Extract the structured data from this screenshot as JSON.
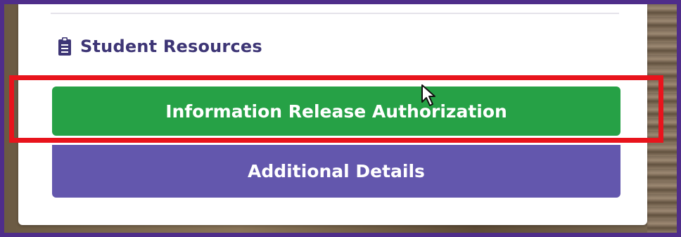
{
  "section": {
    "title": "Student Resources",
    "icon": "clipboard-icon"
  },
  "buttons": {
    "primary_label": "Information Release Authorization",
    "secondary_label": "Additional Details"
  },
  "colors": {
    "primary_button": "#26a146",
    "secondary_button": "#6357ad",
    "highlight": "#e8141c",
    "heading": "#3d3575",
    "page_border": "#4f2d8a"
  }
}
